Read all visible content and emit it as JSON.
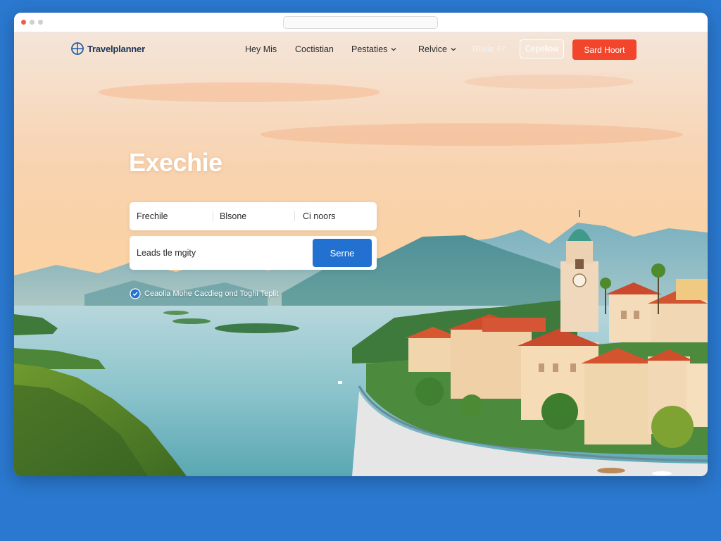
{
  "brand": {
    "name": "Travelplanner",
    "icon": "globe-icon"
  },
  "nav": {
    "items": [
      {
        "label": "Hey Mis",
        "dropdown": false
      },
      {
        "label": "Coctistian",
        "dropdown": false
      },
      {
        "label": "Pestaties",
        "dropdown": true
      },
      {
        "label": "Relvice",
        "dropdown": true
      },
      {
        "label": "Rlalie Fr",
        "dropdown": false
      }
    ],
    "outline_button": "Cepeliow",
    "cta_button": "Sard Hoort"
  },
  "hero": {
    "title": "Exechie",
    "filters": [
      "Frechile",
      "Blsone",
      "Ci noors"
    ],
    "search_value": "Leads tle mgity",
    "search_button": "Serne",
    "tagline": "Ceaolia Mohe Cacdieg ond Toghi Teplit",
    "tagline_icon": "shield-check-icon"
  },
  "colors": {
    "page_background": "#2a78cf",
    "brand": "#1d3557",
    "cta": "#f2452c",
    "search_button": "#2271d0"
  }
}
